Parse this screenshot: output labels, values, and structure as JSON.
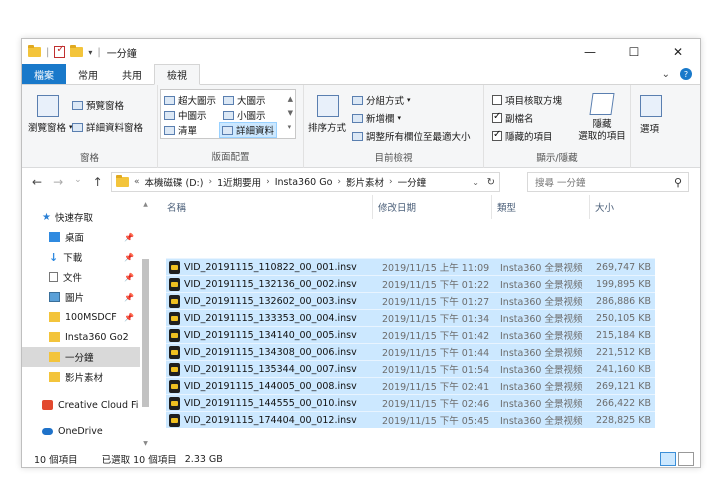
{
  "window": {
    "title": "一分鐘",
    "controls": {
      "minimize": "—",
      "maximize": "☐",
      "close": "✕"
    }
  },
  "tabs": [
    {
      "label": "檔案"
    },
    {
      "label": "常用"
    },
    {
      "label": "共用"
    },
    {
      "label": "檢視"
    }
  ],
  "tab_right": {
    "chevron": "⌄",
    "help": "?"
  },
  "ribbon": {
    "panes": {
      "label": "窗格",
      "navigation_pane": "瀏覽窗格",
      "preview_pane": "預覽窗格",
      "details_pane": "詳細資料窗格"
    },
    "layout": {
      "label": "版面配置",
      "items": [
        "超大圖示",
        "大圖示",
        "中圖示",
        "小圖示",
        "清單",
        "詳細資料"
      ]
    },
    "current_view": {
      "label": "目前檢視",
      "sort_by": "排序方式",
      "group_by": "分組方式",
      "add_columns": "新增欄",
      "fit_columns": "調整所有欄位至最適大小"
    },
    "show_hide": {
      "label": "顯示/隱藏",
      "item_checkboxes": "項目核取方塊",
      "file_extensions": "副檔名",
      "hidden_items": "隱藏的項目",
      "hide_selected_line1": "隱藏",
      "hide_selected_line2": "選取的項目"
    },
    "options": {
      "label": "選項"
    }
  },
  "address": {
    "back": "←",
    "forward": "→",
    "recent": "⌄",
    "up": "↑",
    "overflow": "«",
    "crumbs": [
      "本機磁碟 (D:)",
      "1近期要用",
      "Insta360 Go",
      "影片素材",
      "一分鐘"
    ],
    "search_placeholder": "搜尋 一分鐘"
  },
  "sidebar": {
    "items": [
      {
        "label": "快速存取",
        "pinned": false
      },
      {
        "label": "桌面",
        "pinned": true
      },
      {
        "label": "下載",
        "pinned": true
      },
      {
        "label": "文件",
        "pinned": true
      },
      {
        "label": "圖片",
        "pinned": true
      },
      {
        "label": "100MSDCF",
        "pinned": true
      },
      {
        "label": "Insta360 Go2",
        "pinned": false
      },
      {
        "label": "一分鐘",
        "pinned": false
      },
      {
        "label": "影片素材",
        "pinned": false
      },
      {
        "label": "Creative Cloud Fi",
        "pinned": false
      },
      {
        "label": "OneDrive",
        "pinned": false
      }
    ]
  },
  "columns": [
    "名稱",
    "修改日期",
    "類型",
    "大小"
  ],
  "files": [
    {
      "name": "VID_20191115_110822_00_001.insv",
      "date": "2019/11/15 上午 11:09",
      "type": "Insta360 全景视频",
      "size": "269,747 KB"
    },
    {
      "name": "VID_20191115_132136_00_002.insv",
      "date": "2019/11/15 下午 01:22",
      "type": "Insta360 全景视频",
      "size": "199,895 KB"
    },
    {
      "name": "VID_20191115_132602_00_003.insv",
      "date": "2019/11/15 下午 01:27",
      "type": "Insta360 全景视频",
      "size": "286,886 KB"
    },
    {
      "name": "VID_20191115_133353_00_004.insv",
      "date": "2019/11/15 下午 01:34",
      "type": "Insta360 全景视频",
      "size": "250,105 KB"
    },
    {
      "name": "VID_20191115_134140_00_005.insv",
      "date": "2019/11/15 下午 01:42",
      "type": "Insta360 全景视频",
      "size": "215,184 KB"
    },
    {
      "name": "VID_20191115_134308_00_006.insv",
      "date": "2019/11/15 下午 01:44",
      "type": "Insta360 全景视频",
      "size": "221,512 KB"
    },
    {
      "name": "VID_20191115_135344_00_007.insv",
      "date": "2019/11/15 下午 01:54",
      "type": "Insta360 全景视频",
      "size": "241,160 KB"
    },
    {
      "name": "VID_20191115_144005_00_008.insv",
      "date": "2019/11/15 下午 02:41",
      "type": "Insta360 全景视频",
      "size": "269,121 KB"
    },
    {
      "name": "VID_20191115_144555_00_010.insv",
      "date": "2019/11/15 下午 02:46",
      "type": "Insta360 全景视频",
      "size": "266,422 KB"
    },
    {
      "name": "VID_20191115_174404_00_012.insv",
      "date": "2019/11/15 下午 05:45",
      "type": "Insta360 全景视频",
      "size": "228,825 KB"
    }
  ],
  "status": {
    "count": "10 個項目",
    "selected": "已選取 10 個項目",
    "selected_size": "2.33 GB"
  },
  "colors": {
    "file_tab": "#1979ca",
    "selection": "#cce8ff",
    "folder": "#f3c43b"
  }
}
